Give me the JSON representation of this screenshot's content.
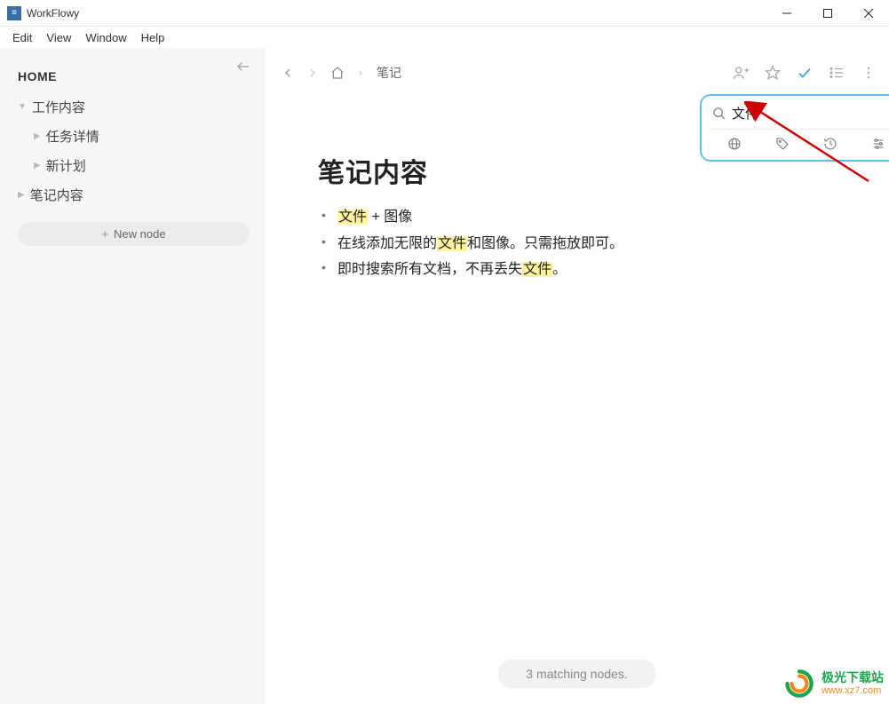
{
  "window": {
    "title": "WorkFlowy"
  },
  "menu": {
    "edit": "Edit",
    "view": "View",
    "window": "Window",
    "help": "Help"
  },
  "sidebar": {
    "home": "HOME",
    "items": [
      {
        "label": "工作内容"
      },
      {
        "label": "任务详情"
      },
      {
        "label": "新计划"
      },
      {
        "label": "笔记内容"
      }
    ],
    "new_node": "New node"
  },
  "breadcrumb": {
    "item": "笔记"
  },
  "search": {
    "value": "文件",
    "filters": {
      "history_label": "history",
      "more": "…"
    }
  },
  "page": {
    "title": "笔记内容",
    "bullets": [
      {
        "pre": "",
        "hl": "文件",
        "post": " + 图像"
      },
      {
        "pre": "在线添加无限的",
        "hl": "文件",
        "post": "和图像。只需拖放即可。"
      },
      {
        "pre": "即时搜索所有文档，不再丢失",
        "hl": "文件",
        "post": "。"
      }
    ]
  },
  "status": "3 matching nodes.",
  "watermark": {
    "line1": "极光下载站",
    "line2": "www.xz7.com"
  }
}
